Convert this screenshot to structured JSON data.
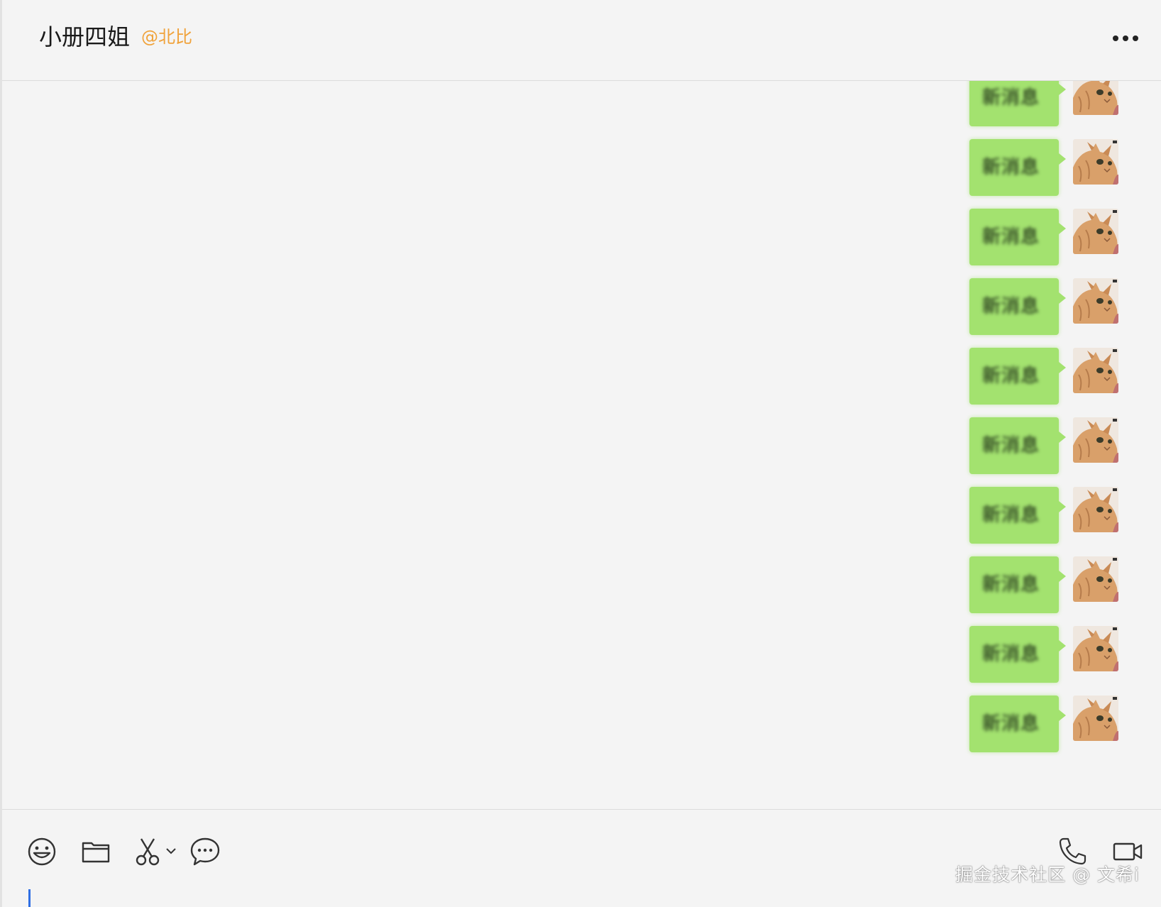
{
  "header": {
    "title": "小册四姐",
    "mention": "@北比",
    "more_icon": "more-dots-icon"
  },
  "messages": [
    {
      "text": "新消息",
      "sender": "self"
    },
    {
      "text": "新消息",
      "sender": "self"
    },
    {
      "text": "新消息",
      "sender": "self"
    },
    {
      "text": "新消息",
      "sender": "self"
    },
    {
      "text": "新消息",
      "sender": "self"
    },
    {
      "text": "新消息",
      "sender": "self"
    },
    {
      "text": "新消息",
      "sender": "self"
    },
    {
      "text": "新消息",
      "sender": "self"
    },
    {
      "text": "新消息",
      "sender": "self"
    },
    {
      "text": "新消息",
      "sender": "self"
    }
  ],
  "toolbar": {
    "left_tools": [
      "emoji-icon",
      "folder-icon",
      "scissors-icon",
      "chat-bubble-icon"
    ],
    "right_tools": [
      "phone-icon",
      "video-camera-icon"
    ]
  },
  "input": {
    "value": ""
  },
  "watermark": "掘金技术社区 @ 文希i",
  "colors": {
    "bubble": "#a3e26f",
    "mention": "#f0a23a",
    "caret": "#2f6fe4",
    "background": "#f4f4f4"
  }
}
